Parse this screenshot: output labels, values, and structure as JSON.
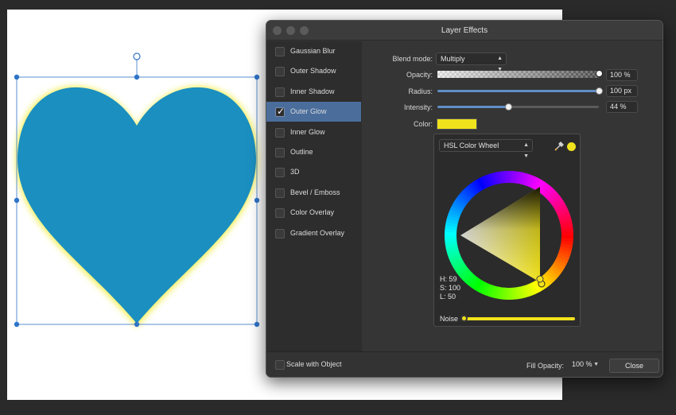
{
  "dialog": {
    "title": "Layer Effects"
  },
  "effects": [
    {
      "label": "Gaussian Blur",
      "checked": false,
      "selected": false
    },
    {
      "label": "Outer Shadow",
      "checked": false,
      "selected": false
    },
    {
      "label": "Inner Shadow",
      "checked": false,
      "selected": false
    },
    {
      "label": "Outer Glow",
      "checked": true,
      "selected": true
    },
    {
      "label": "Inner Glow",
      "checked": false,
      "selected": false
    },
    {
      "label": "Outline",
      "checked": false,
      "selected": false
    },
    {
      "label": "3D",
      "checked": false,
      "selected": false
    },
    {
      "label": "Bevel / Emboss",
      "checked": false,
      "selected": false
    },
    {
      "label": "Color Overlay",
      "checked": false,
      "selected": false
    },
    {
      "label": "Gradient Overlay",
      "checked": false,
      "selected": false
    }
  ],
  "settings": {
    "blend_mode_label": "Blend mode:",
    "blend_mode_value": "Multiply",
    "opacity_label": "Opacity:",
    "opacity_value": "100 %",
    "opacity_fraction": 1.0,
    "radius_label": "Radius:",
    "radius_value": "100 px",
    "radius_fraction": 1.0,
    "intensity_label": "Intensity:",
    "intensity_value": "44 %",
    "intensity_fraction": 0.44,
    "color_label": "Color:",
    "color_hex": "#f0e21c"
  },
  "picker": {
    "mode": "HSL Color Wheel",
    "h": "H: 59",
    "s": "S: 100",
    "l": "L: 50",
    "noise_label": "Noise",
    "noise_fraction": 0.0
  },
  "footer": {
    "scale_label": "Scale with Object",
    "fill_opacity_label": "Fill Opacity:",
    "fill_opacity_value": "100 %",
    "close_label": "Close"
  },
  "colors": {
    "heart": "#1b8fc0",
    "glow": "#f3ef52",
    "selection": "#2f74c8",
    "accent": "#5f8ec6"
  },
  "icons": [
    "eyedropper-icon",
    "checkmark-icon",
    "chevron-updown-icon",
    "chevron-down-icon"
  ]
}
